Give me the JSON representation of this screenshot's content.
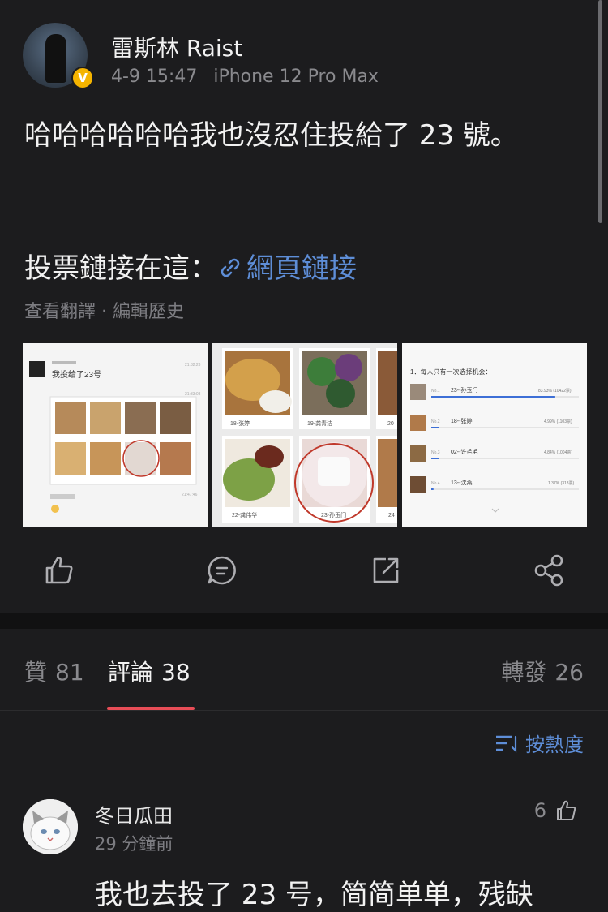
{
  "post": {
    "username": "雷斯林 Raist",
    "verified_badge": "V",
    "time": "4-9 15:47",
    "device": "iPhone 12 Pro Max",
    "content": "哈哈哈哈哈哈我也沒忍住投給了 23 號。",
    "vote_link_prefix": "投票鏈接在這：",
    "web_link_label": "網頁鏈接",
    "translate_link": "查看翻譯 · 編輯歷史",
    "images": [
      {
        "name": "chat-screenshot",
        "time1": "21:32:23",
        "line1": "我投给了23号",
        "time2": "21:33:03",
        "time3": "21:47:46"
      },
      {
        "name": "vote-cards-screenshot",
        "labels": [
          "18-张婷",
          "19-龚青洁",
          "20",
          "22-龚伟华",
          "23-孙玉门",
          "24"
        ]
      },
      {
        "name": "vote-results-screenshot",
        "header": "1．每人只有一次选择机会：",
        "rows": [
          {
            "rank": "No.1",
            "name": "23--孙玉门",
            "pct": "83.93% (10422票)",
            "fill": 0.84
          },
          {
            "rank": "No.2",
            "name": "18--张婷",
            "pct": "4.99% (1103票)",
            "fill": 0.05
          },
          {
            "rank": "No.3",
            "name": "02--许毛毛",
            "pct": "4.84% (1004票)",
            "fill": 0.05
          },
          {
            "rank": "No.4",
            "name": "13--沈燕",
            "pct": "1.37% (318票)",
            "fill": 0.015
          }
        ]
      }
    ]
  },
  "actions": {
    "like_icon": "thumb-up-icon",
    "comment_icon": "comment-bubble-icon",
    "repost_icon": "share-out-icon",
    "share_icon": "share-nodes-icon"
  },
  "tabs": {
    "likes_label": "贊",
    "likes_count": "81",
    "comments_label": "評論",
    "comments_count": "38",
    "reposts_label": "轉發",
    "reposts_count": "26"
  },
  "sort": {
    "label": "按熱度"
  },
  "comment": {
    "name": "冬日瓜田",
    "time": "29 分鐘前",
    "like_count": "6",
    "text": "我也去投了 23 号，简简单单，残缺"
  },
  "colors": {
    "background": "#1c1c1e",
    "link": "#5e8ed8",
    "tab_underline": "#e84d57",
    "verified": "#f5b400"
  }
}
